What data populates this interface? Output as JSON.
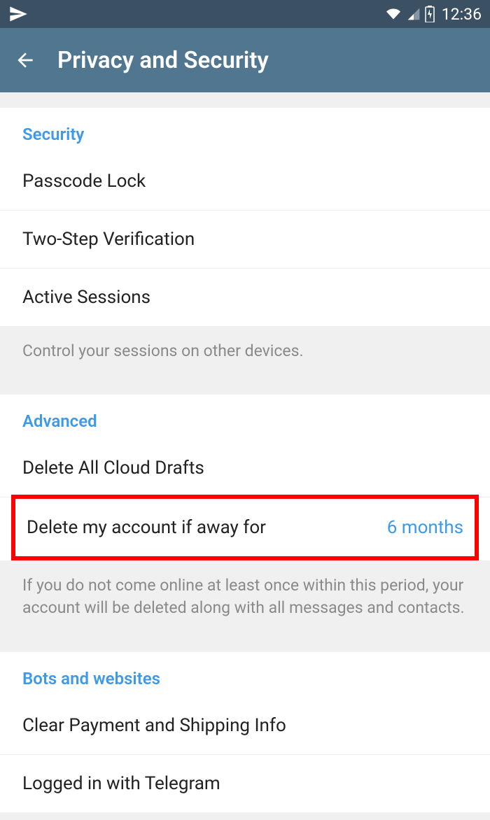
{
  "status_bar": {
    "time": "12:36"
  },
  "header": {
    "title": "Privacy and Security"
  },
  "sections": {
    "security": {
      "title": "Security",
      "items": {
        "passcode": "Passcode Lock",
        "two_step": "Two-Step Verification",
        "sessions": "Active Sessions"
      },
      "footer": "Control your sessions on other devices."
    },
    "advanced": {
      "title": "Advanced",
      "items": {
        "delete_drafts": "Delete All Cloud Drafts",
        "delete_account_label": "Delete my account if away for",
        "delete_account_value": "6 months"
      },
      "footer": "If you do not come online at least once within this period, your account will be deleted along with all messages and contacts."
    },
    "bots": {
      "title": "Bots and websites",
      "items": {
        "clear_payment": "Clear Payment and Shipping Info",
        "logged_in": "Logged in with Telegram"
      }
    }
  }
}
